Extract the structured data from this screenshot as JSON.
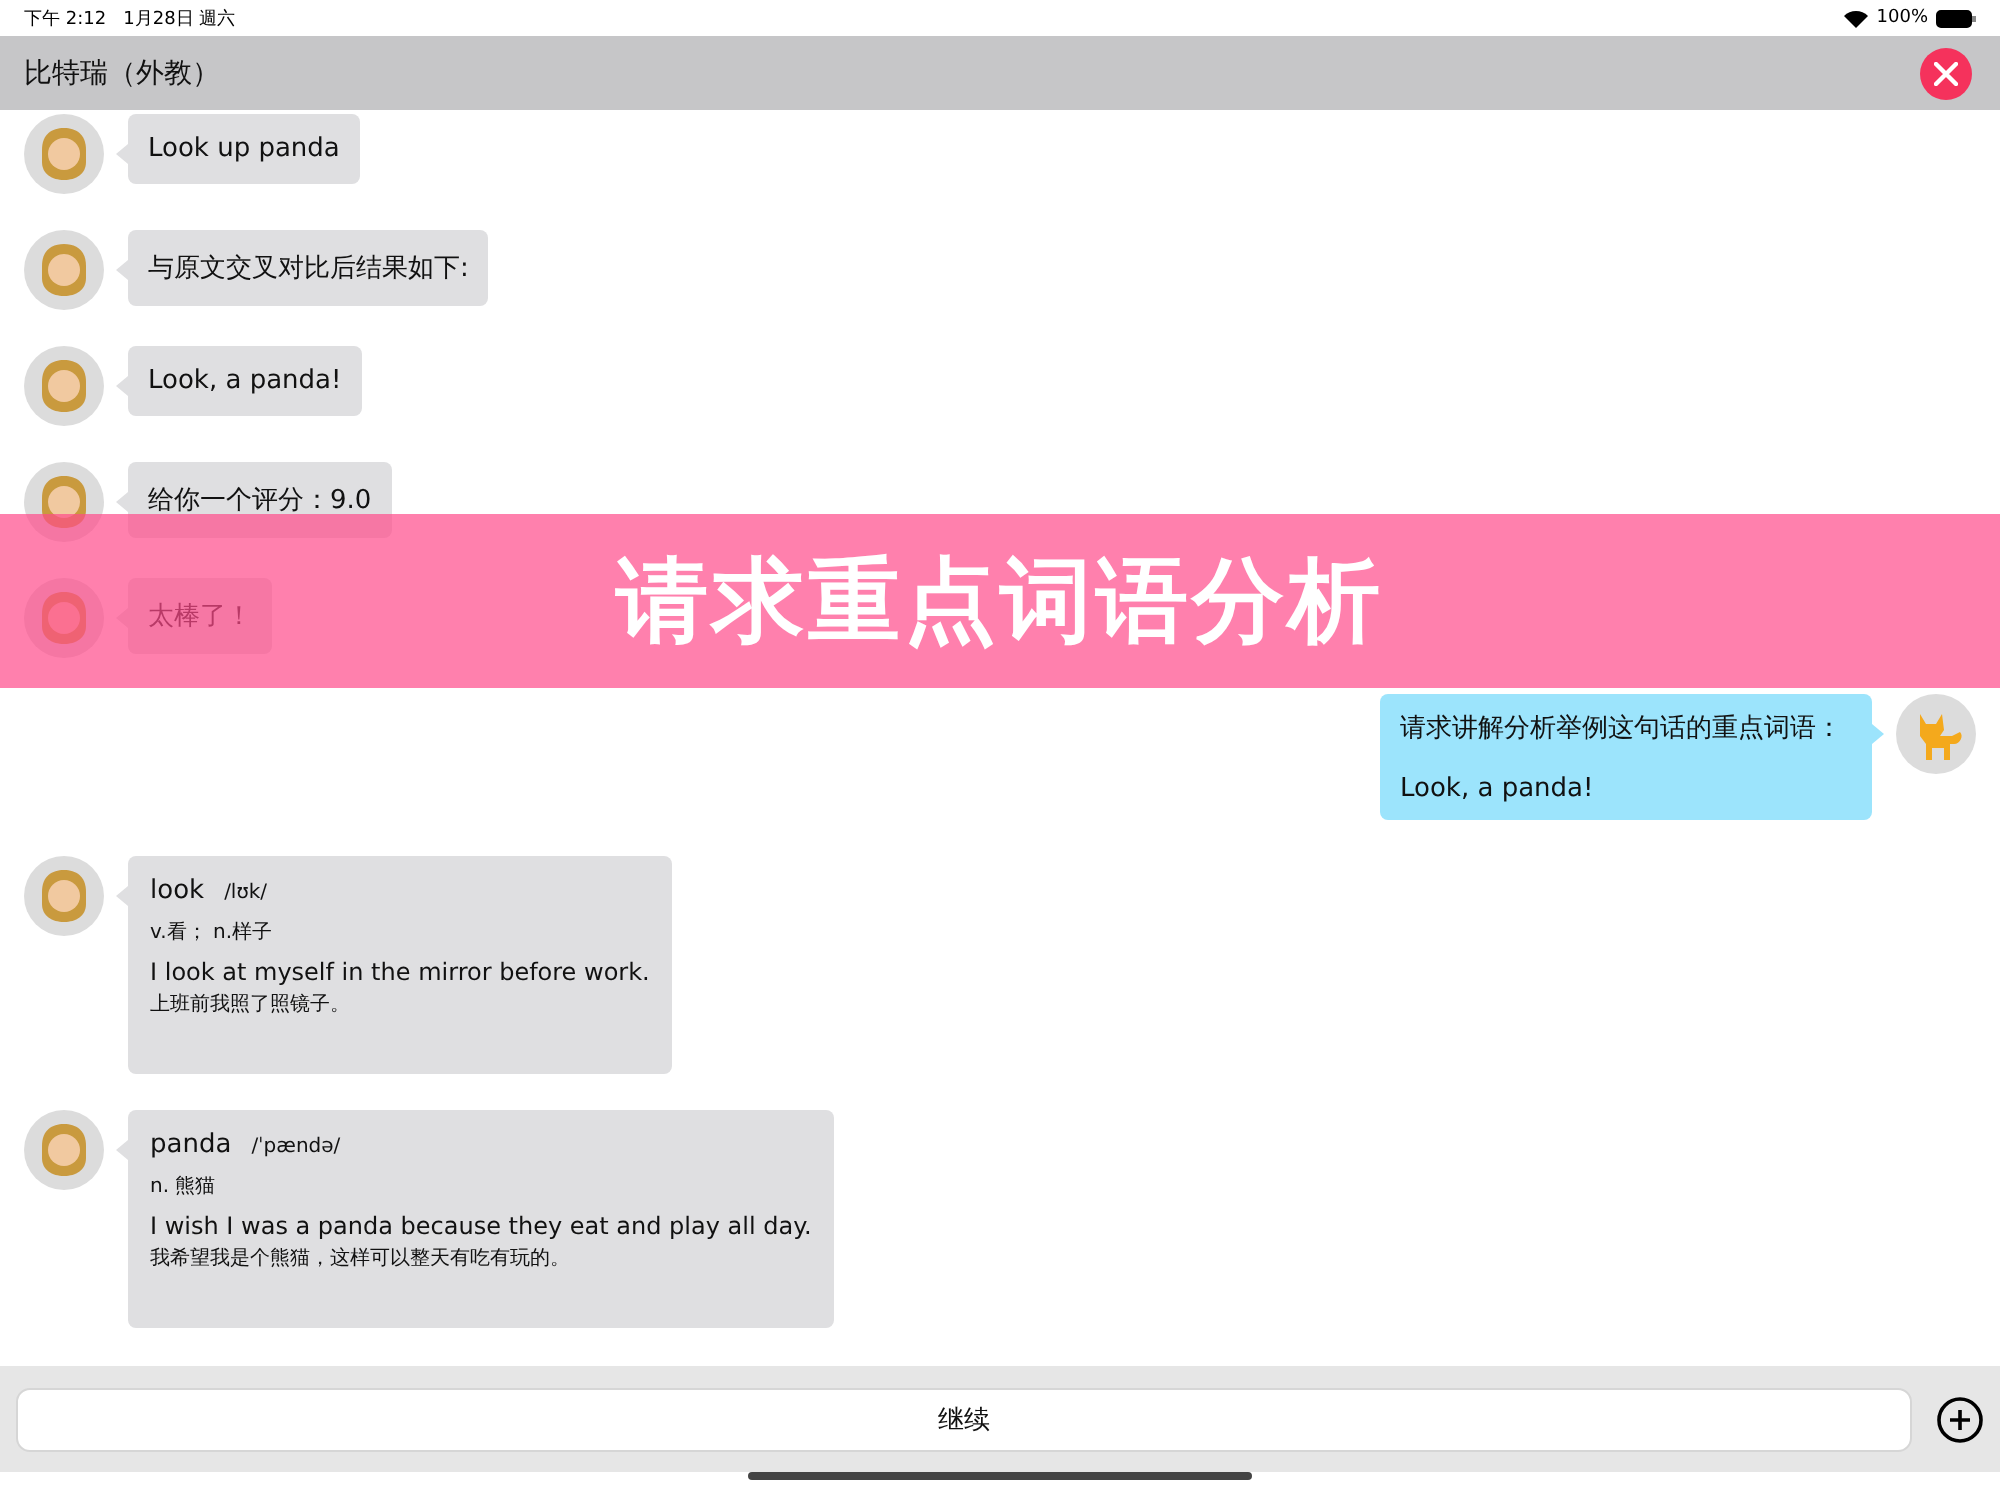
{
  "status_bar": {
    "time": "下午 2:12",
    "date": "1月28日 週六",
    "battery": "100%"
  },
  "header": {
    "title": "比特瑞（外教）"
  },
  "messages": [
    {
      "kind": "text",
      "outgoing": false,
      "text": "Look up panda"
    },
    {
      "kind": "text",
      "outgoing": false,
      "text": "与原文交叉对比后结果如下:"
    },
    {
      "kind": "text",
      "outgoing": false,
      "text": "Look, a panda!"
    },
    {
      "kind": "text",
      "outgoing": false,
      "text": "给你一个评分：9.0"
    },
    {
      "kind": "text",
      "outgoing": false,
      "text": "太棒了！"
    },
    {
      "kind": "request",
      "outgoing": true,
      "lines": [
        "请求讲解分析举例这句话的重点词语：",
        "Look, a panda!"
      ]
    },
    {
      "kind": "word",
      "outgoing": false,
      "word": "look",
      "phonetic": "/lʊk/",
      "meaning": "v.看；  n.样子",
      "example": "I look at myself in the mirror before work.",
      "translation": "上班前我照了照镜子。"
    },
    {
      "kind": "word",
      "outgoing": false,
      "word": "panda",
      "phonetic": "/ˈpændə/",
      "meaning": "n. 熊猫",
      "example": "I wish I was a panda because they eat and play all day.",
      "translation": "我希望我是个熊猫，这样可以整天有吃有玩的。"
    }
  ],
  "banner": {
    "text": "请求重点词语分析"
  },
  "input": {
    "value": "继续"
  }
}
